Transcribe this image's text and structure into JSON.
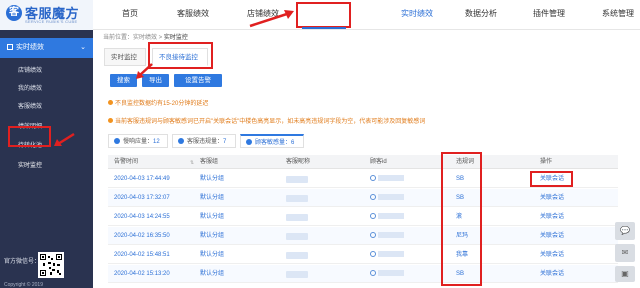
{
  "logo": {
    "mark": "客",
    "title": "客服魔方",
    "subtitle": "SERVICE RUBIK'S CUBE"
  },
  "nav": [
    {
      "label": "首页"
    },
    {
      "label": "客服绩效"
    },
    {
      "label": "店铺绩效"
    },
    {
      "label": "实时绩效"
    },
    {
      "label": "数据分析"
    },
    {
      "label": "插件管理"
    },
    {
      "label": "系统管理"
    }
  ],
  "sidebar": {
    "head": "实时绩效",
    "items": [
      {
        "label": "店铺绩效"
      },
      {
        "label": "我的绩效"
      },
      {
        "label": "客服绩效"
      },
      {
        "label": "绩效明细"
      },
      {
        "label": "待转化池"
      },
      {
        "label": "实时监控"
      }
    ],
    "wechat": "官方微信号：",
    "copyright": "Copyright © 2019"
  },
  "breadcrumb": {
    "prefix": "当前位置：",
    "path": "实时绩效 >",
    "current": "实时监控"
  },
  "tabs": [
    {
      "label": "实时监控"
    },
    {
      "label": "不良接待监控"
    }
  ],
  "buttons": {
    "search": "搜索",
    "export": "导出",
    "alert": "设置告警"
  },
  "notices": [
    "不良监控数据约有15-20分钟的延迟",
    "当前客服违规词与顾客敏感词已开启\"关联会话\"中楼色高亮显示，如未高亮违规词字段为空，代表可能涉及回复敏感词"
  ],
  "stats": [
    {
      "label": "慢响应量：",
      "value": "12"
    },
    {
      "label": "客服违规量：",
      "value": "7"
    },
    {
      "label": "顾客敏感量：",
      "value": "6"
    }
  ],
  "table": {
    "headers": [
      "告警时间",
      "客服组",
      "客服昵称",
      "顾客id",
      "违规词",
      "操作"
    ],
    "sort_glyph": "⇅",
    "rows": [
      {
        "time": "2020-04-03 17:44:49",
        "group": "默认分组",
        "word": "SB",
        "op": "关联会话"
      },
      {
        "time": "2020-04-03 17:32:07",
        "group": "默认分组",
        "word": "SB",
        "op": "关联会话"
      },
      {
        "time": "2020-04-03 14:24:55",
        "group": "默认分组",
        "word": "滚",
        "op": "关联会话"
      },
      {
        "time": "2020-04-02 16:35:50",
        "group": "默认分组",
        "word": "尼玛",
        "op": "关联会话"
      },
      {
        "time": "2020-04-02 15:48:51",
        "group": "默认分组",
        "word": "我靠",
        "op": "关联会话"
      },
      {
        "time": "2020-04-02 15:13:20",
        "group": "默认分组",
        "word": "SB",
        "op": "关联会话"
      }
    ]
  },
  "colors": {
    "accent": "#2f79e0",
    "sidebar": "#2a3350",
    "highlight": "#e02020",
    "warning": "#e07b1a"
  }
}
